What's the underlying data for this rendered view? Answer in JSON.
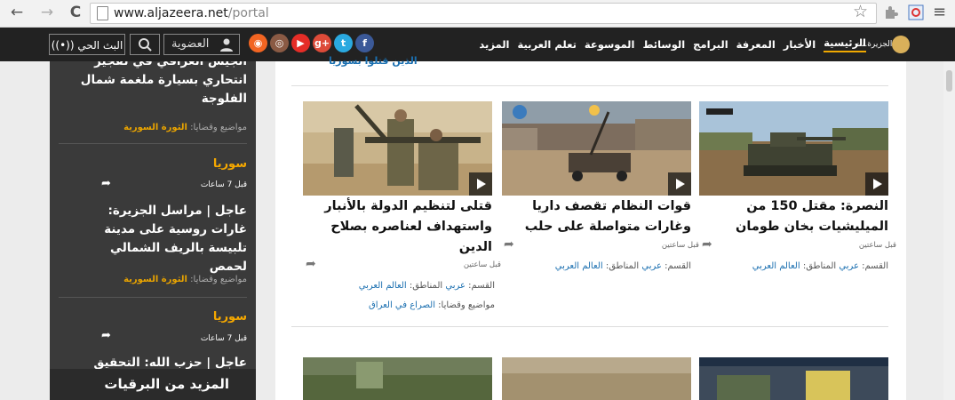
{
  "browser": {
    "url_domain": "www.aljazeera.net",
    "url_path": "/portal",
    "back_icon": "←",
    "forward_icon": "→",
    "reload_icon": "C",
    "star_icon": "☆",
    "menu_icon": "≡"
  },
  "header": {
    "live_label": "البث الحي",
    "member_label": "العضوية",
    "nav": [
      "الرئيسية",
      "الأخبار",
      "المعرفة",
      "البرامج",
      "الوسائط",
      "الموسوعة",
      "تعلم العربية",
      "المزيد"
    ],
    "logo_text": "الجزيرة.نت",
    "social": [
      {
        "name": "rss-icon",
        "glyph": "◉",
        "color": "#f26522"
      },
      {
        "name": "instagram-icon",
        "glyph": "◎",
        "color": "#8a5a44"
      },
      {
        "name": "youtube-icon",
        "glyph": "▶",
        "color": "#e52d27"
      },
      {
        "name": "googleplus-icon",
        "glyph": "g+",
        "color": "#dd4b39"
      },
      {
        "name": "twitter-icon",
        "glyph": "t",
        "color": "#2aa9e0"
      },
      {
        "name": "facebook-icon",
        "glyph": "f",
        "color": "#3b5998"
      }
    ]
  },
  "sidebar": {
    "item1_title": "الجيش العراقي في تفجير انتحاري بسيارة ملغمة شمال الفلوجة",
    "item1_meta_label": "مواضيع وقضايا:",
    "item1_meta_link": "الثورة السورية",
    "item2_category": "سوريا",
    "item2_time": "قبل 7 ساعات",
    "item2_title": "عاجل | مراسل الجزيرة: غارات روسية على مدينة تلبيسة بالريف الشمالي لحمص",
    "item2_meta_label": "مواضيع وقضايا:",
    "item2_meta_link": "الثورة السورية",
    "item3_category": "سوريا",
    "item3_time": "قبل 7 ساعات",
    "item3_title": "عاجل | حزب الله: التحقيق",
    "more_label": "المزيد من البرقيات"
  },
  "content": {
    "top_link": "الذين قتلوا بسوريا",
    "articles": [
      {
        "title": "النصرة: مقتل 150 من الميليشيات بخان طومان",
        "time": "قبل ساعتين",
        "section_label": "القسم:",
        "section_link": "عربي",
        "region_label": "المناطق:",
        "region_link": "العالم العربي"
      },
      {
        "title": "قوات النظام تقصف داريا وغارات متواصلة على حلب",
        "time": "قبل ساعتين",
        "section_label": "القسم:",
        "section_link": "عربي",
        "region_label": "المناطق:",
        "region_link": "العالم العربي"
      },
      {
        "title": "قتلى لتنظيم الدولة بالأنبار واستهداف لعناصره بصلاح الدين",
        "time": "قبل ساعتين",
        "section_label": "القسم:",
        "section_link": "عربي",
        "region_label": "المناطق:",
        "region_link": "العالم العربي",
        "topics_label": "مواضيع وقضايا:",
        "topics_link": "الصراع في العراق"
      }
    ]
  }
}
